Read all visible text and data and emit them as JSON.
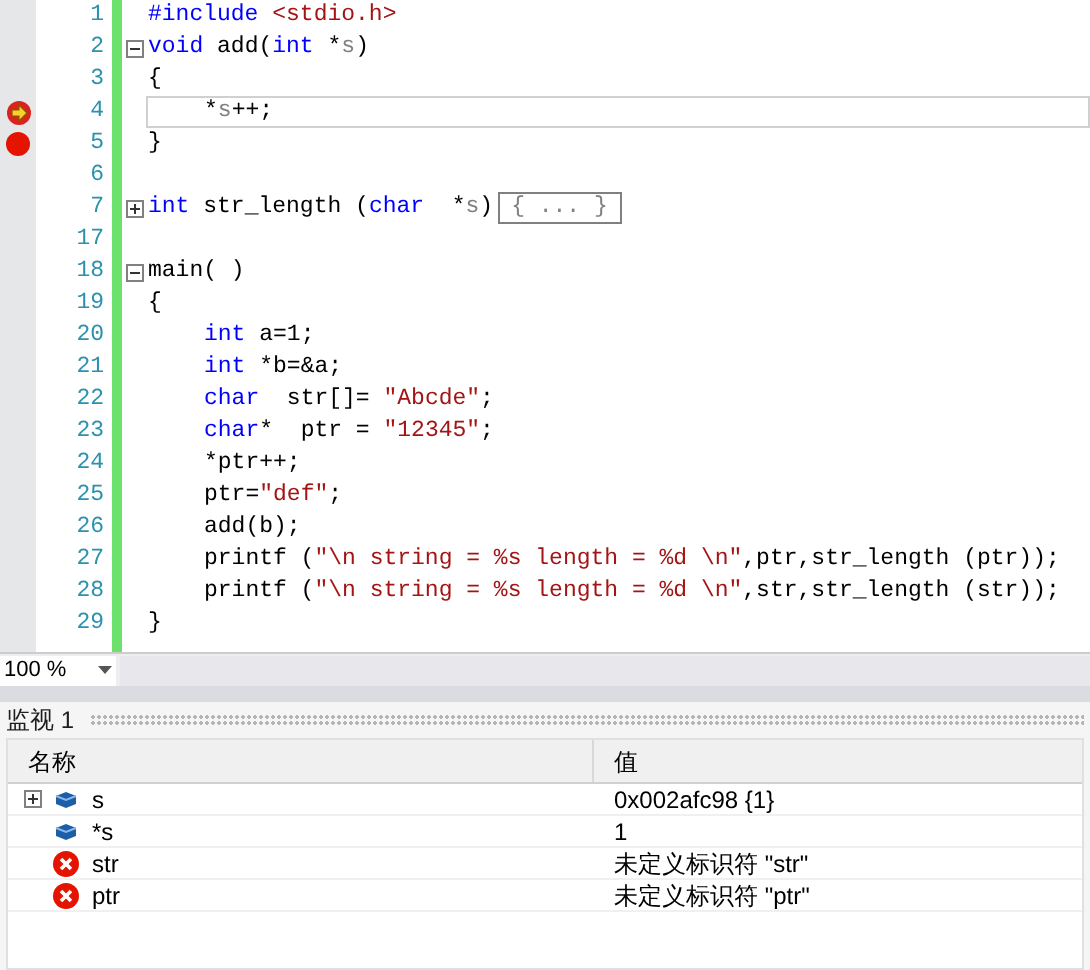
{
  "editor": {
    "lines": [
      {
        "number": "1",
        "breakpoint": false,
        "current": false,
        "tokens": [
          {
            "kind": "keyword",
            "text": "#include "
          },
          {
            "kind": "string",
            "text": "<stdio.h>"
          }
        ]
      },
      {
        "number": "2",
        "breakpoint": false,
        "current": false,
        "fold_expanded": true,
        "tokens": [
          {
            "kind": "keyword",
            "text": "void"
          },
          {
            "kind": "plain",
            "text": " add("
          },
          {
            "kind": "keyword",
            "text": "int"
          },
          {
            "kind": "plain",
            "text": " *"
          },
          {
            "kind": "param",
            "text": "s"
          },
          {
            "kind": "plain",
            "text": ")"
          }
        ]
      },
      {
        "number": "3",
        "breakpoint": false,
        "current": false,
        "tokens": [
          {
            "kind": "plain",
            "text": "{"
          }
        ]
      },
      {
        "number": "4",
        "breakpoint": false,
        "current": true,
        "indented": true,
        "tokens": [
          {
            "kind": "plain",
            "text": "*"
          },
          {
            "kind": "param",
            "text": "s"
          },
          {
            "kind": "plain",
            "text": "++;"
          }
        ]
      },
      {
        "number": "5",
        "breakpoint": true,
        "current": false,
        "tokens": [
          {
            "kind": "plain",
            "text": "}"
          }
        ]
      },
      {
        "number": "6",
        "breakpoint": false,
        "current": false
      },
      {
        "number": "7",
        "breakpoint": false,
        "current": false,
        "fold_expanded": false,
        "tokens": [
          {
            "kind": "keyword",
            "text": "int"
          },
          {
            "kind": "plain",
            "text": " str_length ("
          },
          {
            "kind": "keyword",
            "text": "char"
          },
          {
            "kind": "plain",
            "text": "  *"
          },
          {
            "kind": "param",
            "text": "s"
          },
          {
            "kind": "plain",
            "text": ")"
          },
          {
            "kind": "collapsed",
            "text": "{ ... }"
          }
        ]
      },
      {
        "number": "17",
        "breakpoint": false,
        "current": false
      },
      {
        "number": "18",
        "breakpoint": false,
        "current": false,
        "fold_expanded": true,
        "tokens": [
          {
            "kind": "plain",
            "text": "main( )"
          }
        ]
      },
      {
        "number": "19",
        "breakpoint": false,
        "current": false,
        "tokens": [
          {
            "kind": "plain",
            "text": "{"
          }
        ]
      },
      {
        "number": "20",
        "breakpoint": false,
        "current": false,
        "indented": true,
        "tokens": [
          {
            "kind": "keyword",
            "text": "int"
          },
          {
            "kind": "plain",
            "text": " a=1;"
          }
        ]
      },
      {
        "number": "21",
        "breakpoint": false,
        "current": false,
        "indented": true,
        "tokens": [
          {
            "kind": "keyword",
            "text": "int"
          },
          {
            "kind": "plain",
            "text": " *b=&a;"
          }
        ]
      },
      {
        "number": "22",
        "breakpoint": false,
        "current": false,
        "indented": true,
        "tokens": [
          {
            "kind": "keyword",
            "text": "char"
          },
          {
            "kind": "plain",
            "text": "  str[]= "
          },
          {
            "kind": "string",
            "text": "\"Abcde\""
          },
          {
            "kind": "plain",
            "text": ";"
          }
        ]
      },
      {
        "number": "23",
        "breakpoint": false,
        "current": false,
        "indented": true,
        "tokens": [
          {
            "kind": "keyword",
            "text": "char"
          },
          {
            "kind": "plain",
            "text": "*  ptr = "
          },
          {
            "kind": "string",
            "text": "\"12345\""
          },
          {
            "kind": "plain",
            "text": ";"
          }
        ]
      },
      {
        "number": "24",
        "breakpoint": false,
        "current": false,
        "indented": true,
        "tokens": [
          {
            "kind": "plain",
            "text": "*ptr++;"
          }
        ]
      },
      {
        "number": "25",
        "breakpoint": false,
        "current": false,
        "indented": true,
        "tokens": [
          {
            "kind": "plain",
            "text": "ptr="
          },
          {
            "kind": "string",
            "text": "\"def\""
          },
          {
            "kind": "plain",
            "text": ";"
          }
        ]
      },
      {
        "number": "26",
        "breakpoint": false,
        "current": false,
        "indented": true,
        "tokens": [
          {
            "kind": "plain",
            "text": "add(b);"
          }
        ]
      },
      {
        "number": "27",
        "breakpoint": false,
        "current": false,
        "indented": true,
        "tokens": [
          {
            "kind": "plain",
            "text": "printf ("
          },
          {
            "kind": "string",
            "text": "\"\\n string = %s length = %d \\n\""
          },
          {
            "kind": "plain",
            "text": ",ptr,str_length (ptr));"
          }
        ]
      },
      {
        "number": "28",
        "breakpoint": false,
        "current": false,
        "indented": true,
        "tokens": [
          {
            "kind": "plain",
            "text": "printf ("
          },
          {
            "kind": "string",
            "text": "\"\\n string = %s length = %d \\n\""
          },
          {
            "kind": "plain",
            "text": ",str,str_length (str));"
          }
        ]
      },
      {
        "number": "29",
        "breakpoint": false,
        "current": false,
        "tokens": [
          {
            "kind": "plain",
            "text": "}"
          }
        ]
      }
    ],
    "zoom": "100 %"
  },
  "watch": {
    "title": "监视 1",
    "columns": [
      "名称",
      "值"
    ],
    "rows": [
      {
        "name": "s",
        "value": "0x002afc98 {1}",
        "kind": "variable",
        "expandable": true
      },
      {
        "name": "*s",
        "value": "1",
        "kind": "variable",
        "expandable": false
      },
      {
        "name": "str",
        "value": "未定义标识符 \"str\"",
        "kind": "error",
        "expandable": false
      },
      {
        "name": "ptr",
        "value": "未定义标识符 \"ptr\"",
        "kind": "error",
        "expandable": false
      }
    ]
  }
}
